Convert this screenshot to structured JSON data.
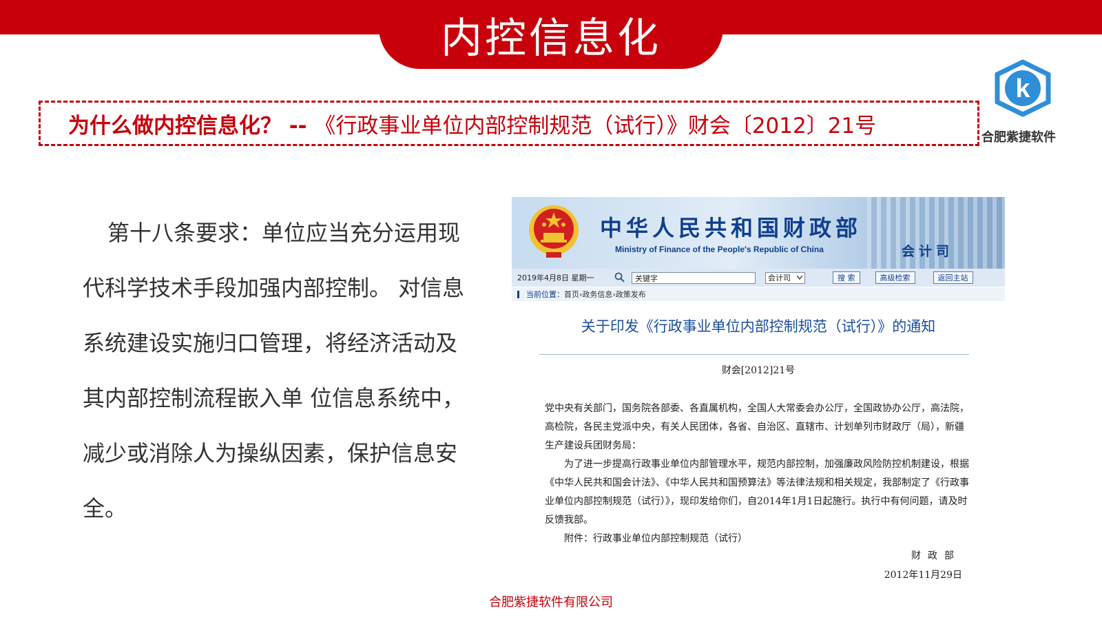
{
  "slide": {
    "title": "内控信息化",
    "question_strong": "为什么做内控信息化？ -- ",
    "question_rest": "《行政事业单位内部控制规范（试行）》财会〔2012〕21号",
    "body_text": "第十八条要求：单位应当充分运用现代科学技术手段加强内部控制。 对信息系统建设实施归口管理，将经济活动及其内部控制流程嵌入单 位信息系统中，减少或消除人为操纵因素，保护信息安全。",
    "footer": "合肥紫捷软件有限公司"
  },
  "logo": {
    "letter": "k",
    "caption": "合肥紫捷软件",
    "color": "#2e8fd8"
  },
  "mof": {
    "name_zh": "中华人民共和国财政部",
    "name_en": "Ministry of Finance of the People's Republic of China",
    "department": "会计司",
    "date_text": "2019年4月8日  星期一",
    "search_value": "关键字",
    "select_value": "会计司",
    "btn_search": "搜 索",
    "btn_advanced": "高级检索",
    "btn_home": "返回主站",
    "breadcrumb_label": "当前位置：",
    "breadcrumb_path": "首页›政务信息›政策发布"
  },
  "notice": {
    "title": "关于印发《行政事业单位内部控制规范（试行）》的通知",
    "doc_no": "财会[2012]21号",
    "addressees": "党中央有关部门，国务院各部委、各直属机构，全国人大常委会办公厅，全国政协办公厅，高法院，高检院，各民主党派中央，有关人民团体，各省、自治区、直辖市、计划单列市财政厅（局），新疆生产建设兵团财务局：",
    "paragraph": "为了进一步提高行政事业单位内部管理水平，规范内部控制，加强廉政风险防控机制建设，根据《中华人民共和国会计法》、《中华人民共和国预算法》等法律法规和相关规定，我部制定了《行政事业单位内部控制规范（试行）》，现印发给你们，自2014年1月1日起施行。执行中有何问题，请及时反馈我部。",
    "attachment": "附件：行政事业单位内部控制规范（试行）",
    "signature": "财政部",
    "date": "2012年11月29日"
  },
  "colors": {
    "brand_red": "#c8000b",
    "mof_blue": "#0f3f8c"
  }
}
